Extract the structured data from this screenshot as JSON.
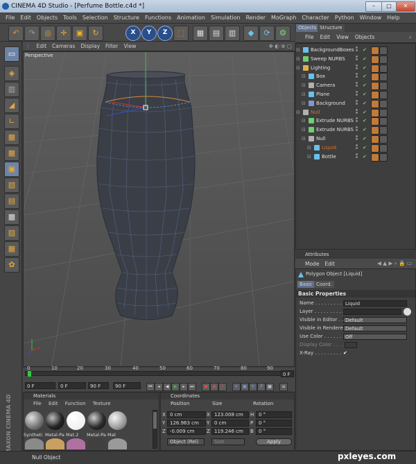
{
  "window": {
    "title": "CINEMA 4D Studio - [Perfume Bottle.c4d *]",
    "minimize": "–",
    "maximize": "□",
    "close": "✕"
  },
  "menubar": [
    "File",
    "Edit",
    "Objects",
    "Tools",
    "Selection",
    "Structure",
    "Functions",
    "Animation",
    "Simulation",
    "Render",
    "MoGraph",
    "Character",
    "Python",
    "Window",
    "Help"
  ],
  "toolbar": {
    "axes": [
      "X",
      "Y",
      "Z"
    ]
  },
  "viewport": {
    "menu": [
      "Edit",
      "Cameras",
      "Display",
      "Filter",
      "View"
    ],
    "label": "Perspective"
  },
  "timeline": {
    "ticks": [
      "0",
      "10",
      "20",
      "30",
      "40",
      "50",
      "60",
      "70",
      "80",
      "90",
      "0 F"
    ],
    "start": "0 F",
    "current": "0 F",
    "end": "90 F",
    "end2": "90 F"
  },
  "materials": {
    "title": "Materials",
    "menu": [
      "File",
      "Edit",
      "Function",
      "Texture"
    ],
    "items": [
      {
        "label": "Syntheti",
        "color": "#8c8c8c"
      },
      {
        "label": "Metal-Pa",
        "color": "#222222"
      },
      {
        "label": "Mat.2",
        "color": "#f4f4f4"
      },
      {
        "label": "Metal-Pa",
        "color": "#333333"
      },
      {
        "label": "Mat",
        "color": "#b5b5b5"
      }
    ]
  },
  "coordinates": {
    "title": "Coordinates",
    "headers": [
      "Position",
      "Size",
      "Rotation"
    ],
    "rows": [
      {
        "axis": "X",
        "pos": "0 cm",
        "saxis": "X",
        "size": "123.008 cm",
        "raxis": "H",
        "rot": "0 °"
      },
      {
        "axis": "Y",
        "pos": "126.963 cm",
        "saxis": "Y",
        "size": "0 cm",
        "raxis": "P",
        "rot": "0 °"
      },
      {
        "axis": "Z",
        "pos": "-0.009 cm",
        "saxis": "Z",
        "size": "119.246 cm",
        "raxis": "B",
        "rot": "0 °"
      }
    ],
    "mode": "Object (Rel)",
    "size_mode": "Size",
    "apply": "Apply"
  },
  "object_manager": {
    "tabs": [
      "Objects",
      "Structure"
    ],
    "menu": [
      "File",
      "Edit",
      "View",
      "Objects"
    ],
    "items": [
      {
        "name": "BackgroundBoxes",
        "color": "#e0e0e0",
        "indent": 0
      },
      {
        "name": "Sweep NURBS",
        "color": "#e0e0e0",
        "indent": 0
      },
      {
        "name": "Lighting",
        "color": "#e0e0e0",
        "indent": 0
      },
      {
        "name": "Box",
        "color": "#e0e0e0",
        "indent": 1
      },
      {
        "name": "Camera",
        "color": "#e0e0e0",
        "indent": 1
      },
      {
        "name": "Plane",
        "color": "#e0e0e0",
        "indent": 1
      },
      {
        "name": "Background",
        "color": "#e0e0e0",
        "indent": 1
      },
      {
        "name": "Null",
        "color": "#e07020",
        "indent": 0
      },
      {
        "name": "Extrude NURBS",
        "color": "#e0e0e0",
        "indent": 1
      },
      {
        "name": "Extrude NURBS",
        "color": "#e0e0e0",
        "indent": 1
      },
      {
        "name": "Null",
        "color": "#e0e0e0",
        "indent": 1
      },
      {
        "name": "Liquid",
        "color": "#e07020",
        "indent": 2
      },
      {
        "name": "Bottle",
        "color": "#e0e0e0",
        "indent": 2
      }
    ]
  },
  "attributes": {
    "title": "Attributes",
    "menu": [
      "Mode",
      "Edit"
    ],
    "object": "Polygon Object [Liquid]",
    "tabs": [
      "Basic",
      "Coord."
    ],
    "section": "Basic Properties",
    "fields": [
      {
        "label": "Name . . . . . . . . . .",
        "value": "Liquid"
      },
      {
        "label": "Layer . . . . . . . . . .",
        "value": ""
      },
      {
        "label": "Visible in Editor . . .",
        "value": "Default"
      },
      {
        "label": "Visible in Renderer",
        "value": "Default"
      },
      {
        "label": "Use Color . . . . . . .",
        "value": "Off"
      },
      {
        "label": "Display Color . . . . .",
        "value": ""
      },
      {
        "label": "X-Ray . . . . . . . . .",
        "value": "✔"
      }
    ]
  },
  "status": "Null Object",
  "watermark": "pxleyes.com",
  "maxon": "MAXON CINEMA 4D"
}
